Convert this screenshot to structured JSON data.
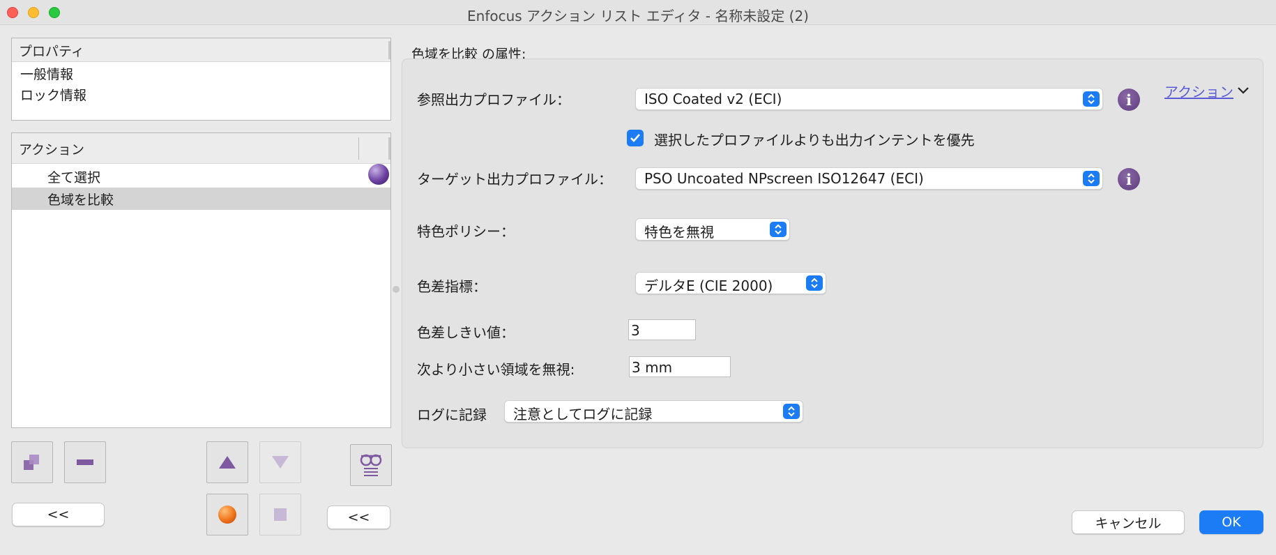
{
  "window": {
    "title": "Enfocus アクション リスト エディタ - 名称未設定 (2)"
  },
  "properties_panel": {
    "header": "プロパティ",
    "items": [
      {
        "label": "一般情報"
      },
      {
        "label": "ロック情報"
      }
    ]
  },
  "actions_panel": {
    "header": "アクション",
    "items": [
      {
        "label": "全て選択",
        "selected": false
      },
      {
        "label": "色域を比較",
        "selected": true
      }
    ]
  },
  "left_buttons": {
    "collapse_left": "<<",
    "collapse_right": "<<"
  },
  "attributes": {
    "heading": "色域を比較 の属性:",
    "actions_link": "アクション",
    "reference_profile": {
      "label": "参照出力プロファイル：",
      "value": "ISO Coated v2 (ECI)"
    },
    "prefer_output_intent": {
      "label": "選択したプロファイルよりも出力インテントを優先",
      "checked": true
    },
    "target_profile": {
      "label": "ターゲット出力プロファイル：",
      "value": "PSO Uncoated NPscreen ISO12647 (ECI)"
    },
    "spot_policy": {
      "label": "特色ポリシー：",
      "value": "特色を無視"
    },
    "color_difference_metric": {
      "label": "色差指標：",
      "value": "デルタE (CIE 2000)"
    },
    "color_difference_threshold": {
      "label": "色差しきい値：",
      "value": "3"
    },
    "ignore_smaller_area": {
      "label": "次より小さい領域を無視:",
      "value": "3 mm"
    },
    "log": {
      "label": "ログに記録",
      "value": "注意としてログに記録"
    }
  },
  "footer": {
    "cancel": "キャンセル",
    "ok": "OK"
  },
  "colors": {
    "accent": "#1b7cf5",
    "icon_purple": "#6b4a8b",
    "link": "#5b5bd6",
    "selected_row": "#d4d4d4"
  }
}
